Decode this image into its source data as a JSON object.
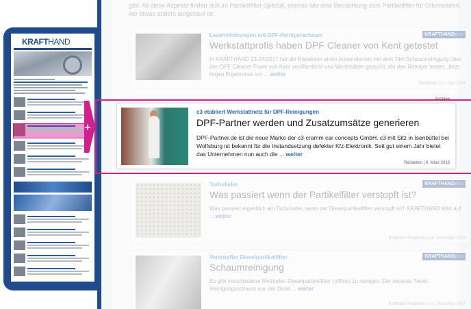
{
  "phone": {
    "logo_bold": "KRAFT",
    "logo_light": "HAND"
  },
  "intro_text": "gibt. All diese Aspekte finden sich im Partikelfilter-Spezial, ebenso wie eine Betrachtung zum Partikelfilter für Ottomotoren, der etwas anders aufgebaut ist.",
  "badge": {
    "bold": "KRAFTHAND",
    "light": "plus"
  },
  "articles": [
    {
      "kicker": "Lesererfahrungen mit DPF-Reinigerschaum",
      "title": "Werkstattprofis haben DPF Cleaner von Kent getestet",
      "teaser": "In KRAFTHAND 23-24/2017 hat die Redaktion einen Anwendertest mit dem Titel Schaumreinigung über den DPF Cleaner Foam von Kent veröffentlicht und Werkstätten gesucht, die den Reiniger testen. Jetzt liegen Ergebnisse vor ...",
      "more": "weiter",
      "meta": "Redaktion | 11. April 2018"
    },
    {
      "kicker": "c3 etabliert Werkstattnetz für DPF-Reinigungen",
      "title": "DPF-Partner werden und Zusatzumsätze generieren",
      "teaser": "DPF-Partner.de ist die neue Marke der c3-cramm car concepts GmbH. c3 mit Sitz in Isenbüttel bei Wolfsburg ist bekannt für die Instandsetzung defekter Kfz-Elektronik. Seit gut einem Jahr bietet das Unternehmen nun auch die ...",
      "more": "weiter",
      "meta": "Redaktion | 6. März 2018",
      "corner": "Anzeige"
    },
    {
      "kicker": "Turbolader",
      "title": "Was passiert wenn der Partikelfilter verstopft ist?",
      "teaser": "Was passiert eigentlich am Turbolader, wenn der Dieselpartikelfilter verstopft ist? KRAFTHAND klärt auf ...",
      "more": "weiter",
      "meta": "Krafthand Redaktion | 28. Dezember 2017"
    },
    {
      "kicker": "Verstopfter Dieselpartikelfilter",
      "title": "Schaumreinigung",
      "teaser": "Es gibt verschiedene Methoden Dieselpartikelfilter (offline) zu reinigen. Der neueste Trend: Reinigungsschaum aus der Dose ...",
      "more": "weiter",
      "meta": "Krafthand Redaktion | 12. Dezember 2017"
    }
  ],
  "colors": {
    "brand": "#1f4a8c",
    "highlight": "#d61f8d",
    "link": "#2a6bc4"
  }
}
